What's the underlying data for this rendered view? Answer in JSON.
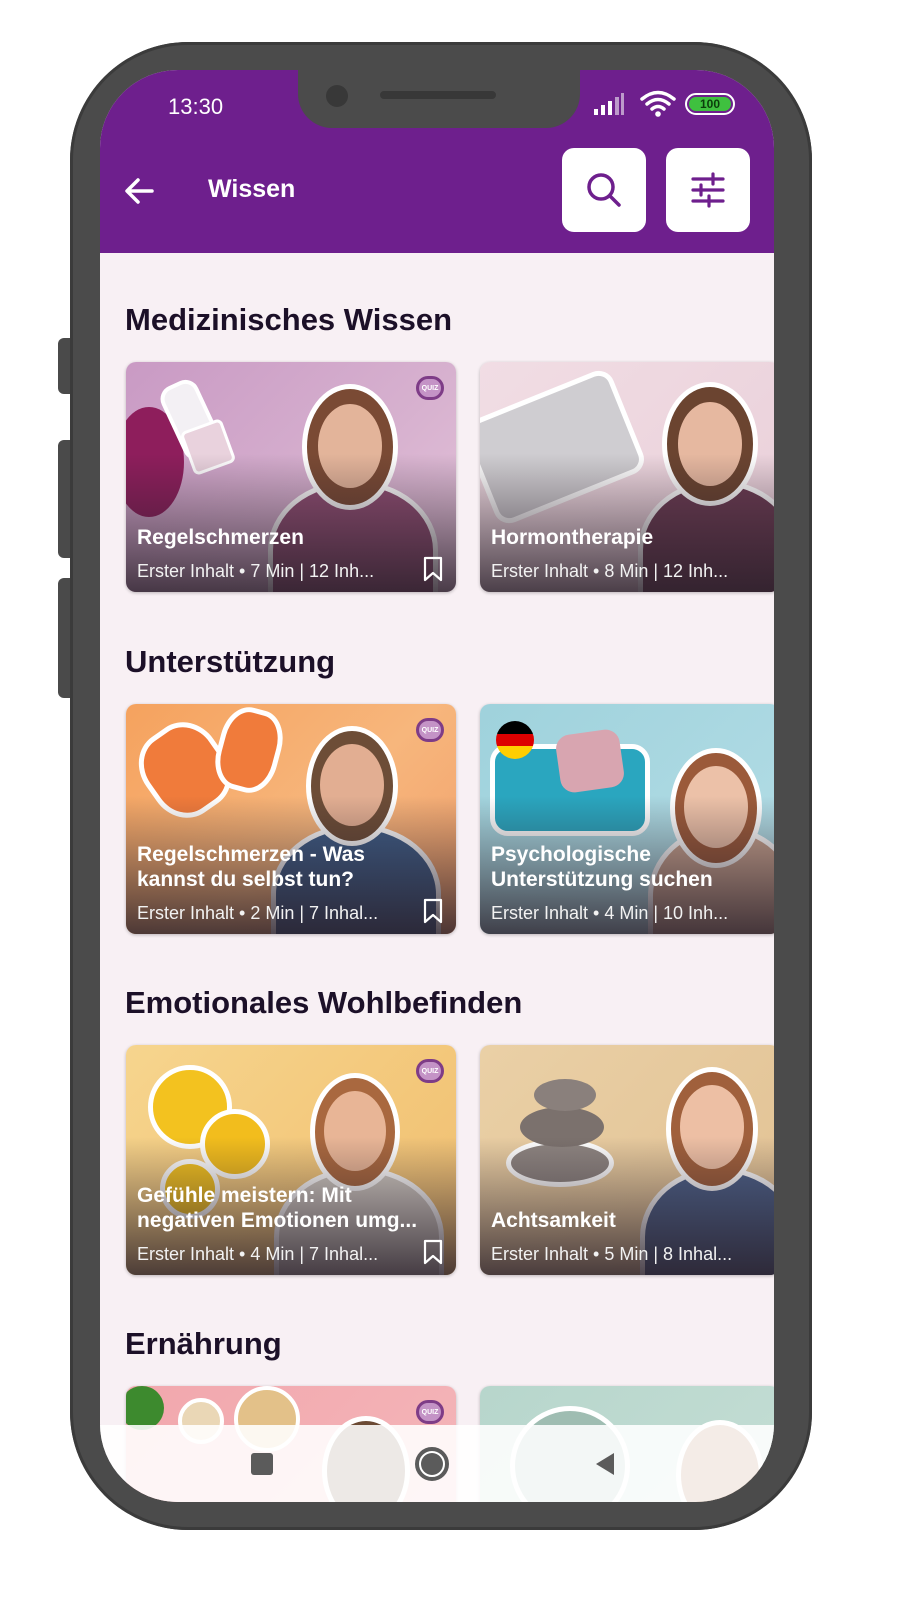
{
  "status_bar": {
    "time": "13:30",
    "battery": "100"
  },
  "app_bar": {
    "title": "Wissen"
  },
  "icons": {
    "back": "arrow-left-icon",
    "search": "search-icon",
    "filter": "sliders-icon",
    "bookmark": "bookmark-icon",
    "quiz": "quiz-badge-icon"
  },
  "colors": {
    "primary": "#6e1f8d",
    "background": "#f8f0f4",
    "on_primary": "#ffffff"
  },
  "sections": [
    {
      "title": "Medizinisches Wissen",
      "cards": [
        {
          "title": "Regelschmerzen",
          "meta": "Erster Inhalt • 7 Min  |  12 Inh...",
          "quiz": "QUIZ"
        },
        {
          "title": "Hormontherapie",
          "meta": "Erster Inhalt • 8 Min  |  12 Inh..."
        }
      ]
    },
    {
      "title": "Unterstützung",
      "cards": [
        {
          "title_line1": "Regelschmerzen - Was",
          "title_line2": "kannst du selbst tun?",
          "meta": "Erster Inhalt • 2 Min  |  7 Inhal...",
          "quiz": "QUIZ"
        },
        {
          "title_line1": "Psychologische",
          "title_line2": "Unterstützung suchen",
          "meta": "Erster Inhalt • 4 Min  |  10 Inh..."
        }
      ]
    },
    {
      "title": "Emotionales Wohlbefinden",
      "cards": [
        {
          "title_line1": "Gefühle meistern: Mit",
          "title_line2": "negativen Emotionen umg...",
          "meta": "Erster Inhalt • 4 Min  |  7 Inhal...",
          "quiz": "QUIZ"
        },
        {
          "title": "Achtsamkeit",
          "meta": "Erster Inhalt • 5 Min  |  8 Inhal..."
        }
      ]
    },
    {
      "title": "Ernährung",
      "cards": [
        {
          "quiz": "QUIZ"
        },
        {}
      ]
    }
  ],
  "nav_bar": {
    "recents": "square-icon",
    "home": "circle-icon",
    "back": "triangle-back-icon"
  }
}
